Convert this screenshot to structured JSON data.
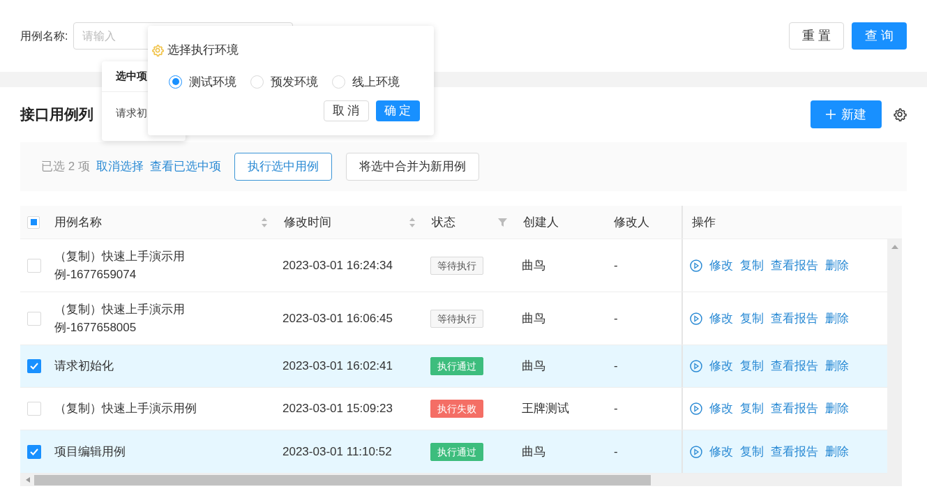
{
  "search": {
    "label": "用例名称:",
    "placeholder": "请输入"
  },
  "search_buttons": [
    {
      "label": "重置",
      "kind": "default"
    },
    {
      "label": "查询",
      "kind": "primary"
    }
  ],
  "selected_popover": {
    "title": "选中项",
    "item": "请求初"
  },
  "env_popover": {
    "title": "选择执行环境",
    "options": [
      {
        "label": "测试环境",
        "selected": true
      },
      {
        "label": "预发环境",
        "selected": false
      },
      {
        "label": "线上环境",
        "selected": false
      }
    ],
    "cancel": "取消",
    "ok": "确定"
  },
  "page_title": "接口用例列",
  "new_button": "新建",
  "selection_bar": {
    "count": "已选 2 项",
    "clear": "取消选择",
    "view": "查看已选中项",
    "buttons": [
      {
        "label": "执行选中用例",
        "kind": "focused"
      },
      {
        "label": "将选中合并为新用例",
        "kind": "default"
      }
    ]
  },
  "table": {
    "indeterminate": true,
    "columns": [
      {
        "label": "用例名称",
        "kind": "sort"
      },
      {
        "label": "修改时间",
        "kind": "sort"
      },
      {
        "label": "状态",
        "kind": "filter"
      },
      {
        "label": "创建人",
        "kind": "plain"
      },
      {
        "label": "修改人",
        "kind": "plain"
      },
      {
        "label": "操作",
        "kind": "plain"
      }
    ],
    "rows": [
      {
        "checked": false,
        "name": "（复制）快速上手演示用例-1677659074",
        "time": "2023-03-01 16:24:34",
        "status": {
          "label": "等待执行",
          "kind": "waiting"
        },
        "creator": "曲鸟",
        "modifier": "-",
        "actions": [
          "修改",
          "复制",
          "查看报告",
          "删除"
        ]
      },
      {
        "checked": false,
        "name": "（复制）快速上手演示用例-1677658005",
        "time": "2023-03-01 16:06:45",
        "status": {
          "label": "等待执行",
          "kind": "waiting"
        },
        "creator": "曲鸟",
        "modifier": "-",
        "actions": [
          "修改",
          "复制",
          "查看报告",
          "删除"
        ]
      },
      {
        "checked": true,
        "name": "请求初始化",
        "time": "2023-03-01 16:02:41",
        "status": {
          "label": "执行通过",
          "kind": "passed"
        },
        "creator": "曲鸟",
        "modifier": "-",
        "actions": [
          "修改",
          "复制",
          "查看报告",
          "删除"
        ]
      },
      {
        "checked": false,
        "name": "（复制）快速上手演示用例",
        "time": "2023-03-01 15:09:23",
        "status": {
          "label": "执行失败",
          "kind": "failed"
        },
        "creator": "王牌测试",
        "modifier": "-",
        "actions": [
          "修改",
          "复制",
          "查看报告",
          "删除"
        ]
      },
      {
        "checked": true,
        "name": "项目编辑用例",
        "time": "2023-03-01 11:10:52",
        "status": {
          "label": "执行通过",
          "kind": "passed"
        },
        "creator": "曲鸟",
        "modifier": "-",
        "actions": [
          "修改",
          "复制",
          "查看报告",
          "删除"
        ]
      }
    ]
  }
}
